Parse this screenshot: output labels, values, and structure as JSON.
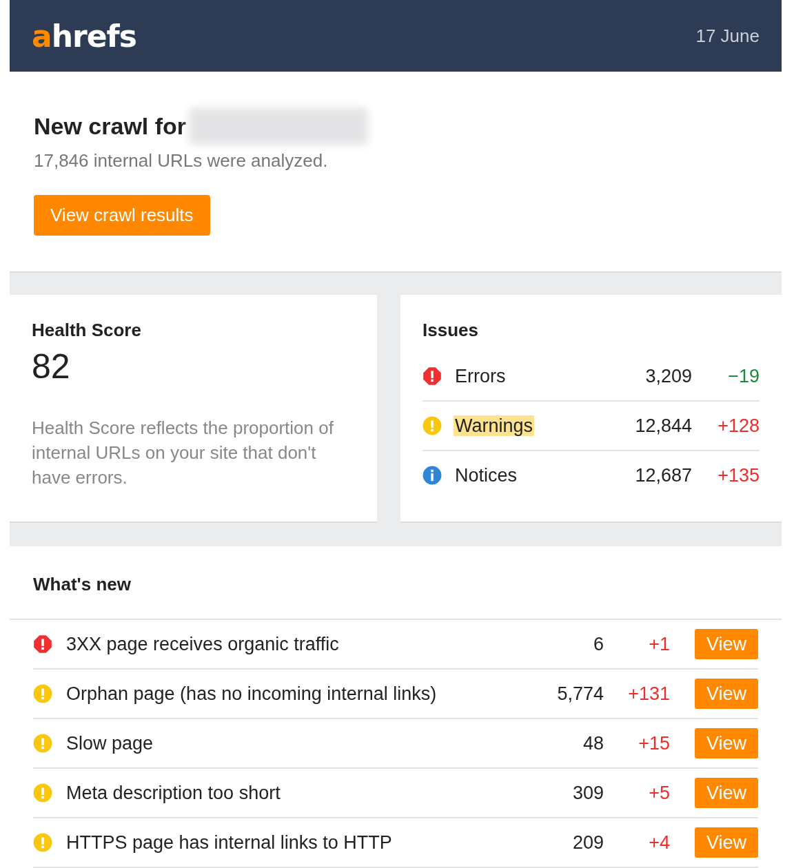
{
  "header": {
    "logo": {
      "accent": "a",
      "rest": "hrefs"
    },
    "date": "17 June"
  },
  "crawl": {
    "title": "New crawl for",
    "subtitle": "17,846 internal URLs were analyzed.",
    "button": "View crawl results"
  },
  "health": {
    "title": "Health Score",
    "score": "82",
    "description": "Health Score reflects the proportion of internal URLs on your site that don't have errors."
  },
  "issues": {
    "title": "Issues",
    "rows": [
      {
        "kind": "error",
        "label": "Errors",
        "highlighted": false,
        "count": "3,209",
        "change": "−19",
        "color": "#1a8a3a"
      },
      {
        "kind": "warning",
        "label": "Warnings",
        "highlighted": true,
        "count": "12,844",
        "change": "+128",
        "color": "#ee2c2c"
      },
      {
        "kind": "notice",
        "label": "Notices",
        "highlighted": false,
        "count": "12,687",
        "change": "+135",
        "color": "#ee2c2c"
      }
    ]
  },
  "whats_new": {
    "title": "What's new",
    "rows": [
      {
        "kind": "error",
        "label": "3XX page receives organic traffic",
        "count": "6",
        "change": "+1",
        "color": "#ee2c2c",
        "button": "View"
      },
      {
        "kind": "warning",
        "label": "Orphan page (has no incoming internal links)",
        "count": "5,774",
        "change": "+131",
        "color": "#ee2c2c",
        "button": "View"
      },
      {
        "kind": "warning",
        "label": "Slow page",
        "count": "48",
        "change": "+15",
        "color": "#ee2c2c",
        "button": "View"
      },
      {
        "kind": "warning",
        "label": "Meta description too short",
        "count": "309",
        "change": "+5",
        "color": "#ee2c2c",
        "button": "View"
      },
      {
        "kind": "warning",
        "label": "HTTPS page has internal links to HTTP",
        "count": "209",
        "change": "+4",
        "color": "#ee2c2c",
        "button": "View"
      }
    ]
  }
}
